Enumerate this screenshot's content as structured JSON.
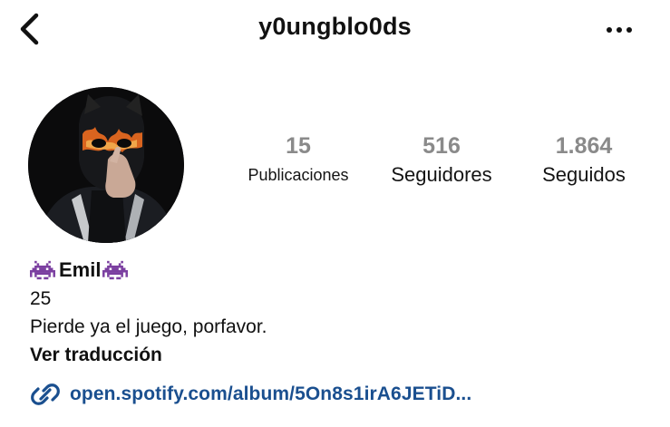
{
  "header": {
    "username": "y0ungblo0ds",
    "back_icon": "chevron-left-icon",
    "more_icon": "more-horizontal-icon"
  },
  "profile": {
    "avatar_icon": "profile-photo"
  },
  "stats": {
    "posts": {
      "value": "15",
      "label": "Publicaciones"
    },
    "followers": {
      "value": "516",
      "label": "Seguidores"
    },
    "following": {
      "value": "1.864",
      "label": "Seguidos"
    }
  },
  "bio": {
    "display_name": "Emil",
    "name_icon": "alien-monster-icon",
    "age": "25",
    "text": "Pierde ya el juego, porfavor.",
    "translate_label": "Ver traducción",
    "link_icon": "link-icon",
    "link_text": "open.spotify.com/album/5On8s1irA6JETiD..."
  },
  "colors": {
    "stat_number": "#8a8a8a",
    "link": "#1a4f8f",
    "alien": "#7b3fa0",
    "avatar_bg": "#0b0b0c"
  }
}
